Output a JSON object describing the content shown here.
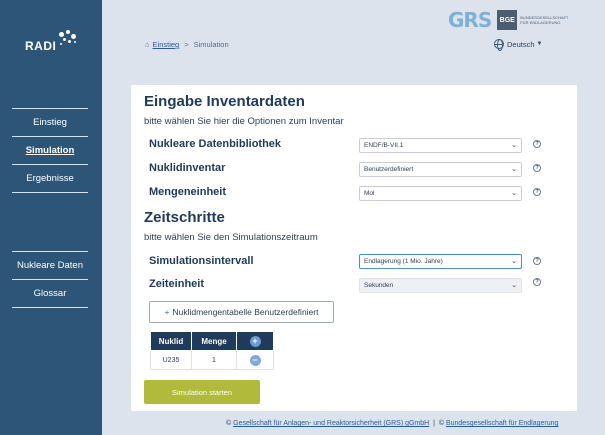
{
  "sidebar": {
    "logo": "RADI",
    "nav_top": [
      {
        "label": "Einstieg",
        "active": false
      },
      {
        "label": "Simulation",
        "active": true
      },
      {
        "label": "Ergebnisse",
        "active": false
      }
    ],
    "nav_bottom": [
      {
        "label": "Nukleare Daten"
      },
      {
        "label": "Glossar"
      }
    ]
  },
  "header": {
    "brand_grs": "GRS",
    "brand_bge": "BGE",
    "brand_bge_sub": "BUNDESGESELLSCHAFT FÜR ENDLAGERUNG",
    "breadcrumb": {
      "home": "Einstieg",
      "separator": ">",
      "current": "Simulation"
    },
    "language": "Deutsch"
  },
  "inventory": {
    "title": "Eingabe Inventardaten",
    "subtitle": "bitte wählen Sie hier die Optionen zum Inventar",
    "fields": [
      {
        "label": "Nukleare Datenbibliothek",
        "value": "ENDF/B-VII.1"
      },
      {
        "label": "Nuklidinventar",
        "value": "Benutzerdefiniert"
      },
      {
        "label": "Mengeneinheit",
        "value": "Mol"
      }
    ]
  },
  "timesteps": {
    "title": "Zeitschritte",
    "subtitle": "bitte wählen Sie den Simulationszeitraum",
    "fields": [
      {
        "label": "Simulationsintervall",
        "value": "Endlagerung (1 Mio. Jahre)"
      },
      {
        "label": "Zeiteinheit",
        "value": "Sekunden"
      }
    ]
  },
  "help_glyph": "?",
  "table_button": {
    "plus": "+",
    "label": "Nuklidmengentabelle Benutzerdefiniert"
  },
  "table": {
    "headers": [
      "Nuklid",
      "Menge"
    ],
    "add_glyph": "+",
    "remove_glyph": "−",
    "rows": [
      {
        "nuklid": "U235",
        "menge": "1"
      }
    ]
  },
  "start_button": "Simulation starten",
  "footer": {
    "copy1": "©",
    "link1": "Gesellschaft für Anlagen- und Reaktorsicherheit (GRS) gGmbH",
    "copy2": "©",
    "link2": "Bundesgesellschaft für Endlagerung"
  },
  "colors": {
    "sidebar": "#2c5578",
    "background": "#dde3ec",
    "heading": "#1f3a5a",
    "start_button": "#b1ba3a"
  }
}
